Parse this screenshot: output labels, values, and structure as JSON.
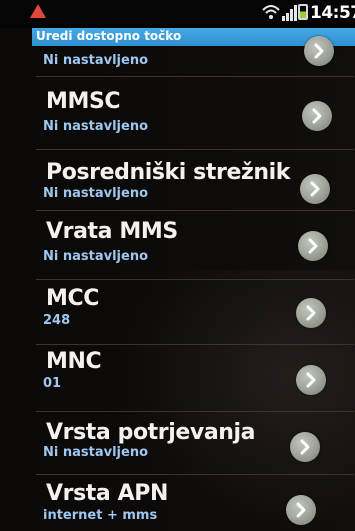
{
  "status_bar": {
    "time": "14:57",
    "icons": [
      "warning-icon",
      "wifi-icon",
      "signal-icon",
      "battery-icon"
    ]
  },
  "header": {
    "title": "Uredi dostopno točko"
  },
  "rows": [
    {
      "title": "",
      "value": "Ni nastavljeno"
    },
    {
      "title": "MMSC",
      "value": "Ni nastavljeno"
    },
    {
      "title": "Posredniški strežnik MMS",
      "value": "Ni nastavljeno"
    },
    {
      "title": "Vrata MMS",
      "value": "Ni nastavljeno"
    },
    {
      "title": "MCC",
      "value": "248"
    },
    {
      "title": "MNC",
      "value": "01"
    },
    {
      "title": "Vrsta potrjevanja",
      "value": "Ni nastavljeno"
    },
    {
      "title": "Vrsta APN",
      "value": "internet + mms"
    }
  ],
  "colors": {
    "accent": "#2f8fd0",
    "value_text": "#9ec7f0",
    "chevron_button": "#a3a99f"
  }
}
